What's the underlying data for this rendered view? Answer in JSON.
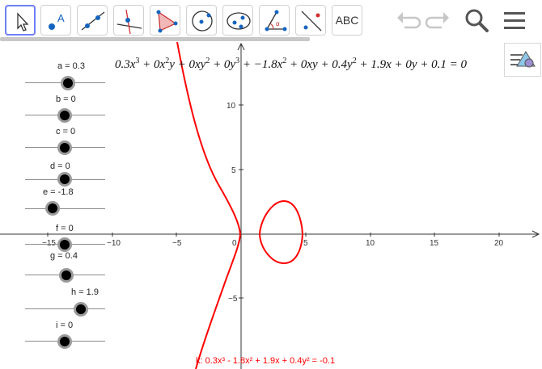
{
  "toolbar": {
    "tools": [
      {
        "name": "move",
        "active": true
      },
      {
        "name": "point"
      },
      {
        "name": "line"
      },
      {
        "name": "perpendicular-line"
      },
      {
        "name": "polygon"
      },
      {
        "name": "circle-center-point"
      },
      {
        "name": "ellipse"
      },
      {
        "name": "angle"
      },
      {
        "name": "reflect"
      },
      {
        "name": "text",
        "label": "ABC"
      }
    ],
    "undo_icon": "undo-icon",
    "redo_icon": "redo-icon",
    "search_icon": "search-icon",
    "menu_icon": "menu-icon"
  },
  "sliders": [
    {
      "label": "a = 0.3",
      "value": 0.3
    },
    {
      "label": "b = 0",
      "value": 0
    },
    {
      "label": "c = 0",
      "value": 0
    },
    {
      "label": "d = 0",
      "value": 0
    },
    {
      "label": "e = -1.8",
      "value": -1.8
    },
    {
      "label": "f = 0",
      "value": 0
    },
    {
      "label": "g = 0.4",
      "value": 0.4
    },
    {
      "label": "h = 1.9",
      "value": 1.9
    },
    {
      "label": "i = 0",
      "value": 0
    }
  ],
  "equation": {
    "t1": "0.3x",
    "e1": "3",
    "t2": " + 0x",
    "e2": "2",
    "t3": "y + 0xy",
    "e3": "2",
    "t4": " + 0y",
    "e4": "3",
    "t5": " + −1.8x",
    "e5": "2",
    "t6": " + 0xy + 0.4y",
    "e6": "2",
    "t7": " + 1.9x + 0y + 0.1 = 0"
  },
  "curve_label": "k: 0.3x³ - 1.8x² + 1.9x + 0.4y² = -0.1",
  "axes": {
    "x_ticks": [
      "−15",
      "−10",
      "−5",
      "0",
      "5",
      "10",
      "15",
      "20"
    ],
    "y_ticks": [
      "10",
      "5",
      "−5"
    ]
  },
  "colors": {
    "curve": "#ff0000",
    "axis": "#333333",
    "active_tool_border": "#6f7ff5",
    "point": "#1565c0"
  }
}
